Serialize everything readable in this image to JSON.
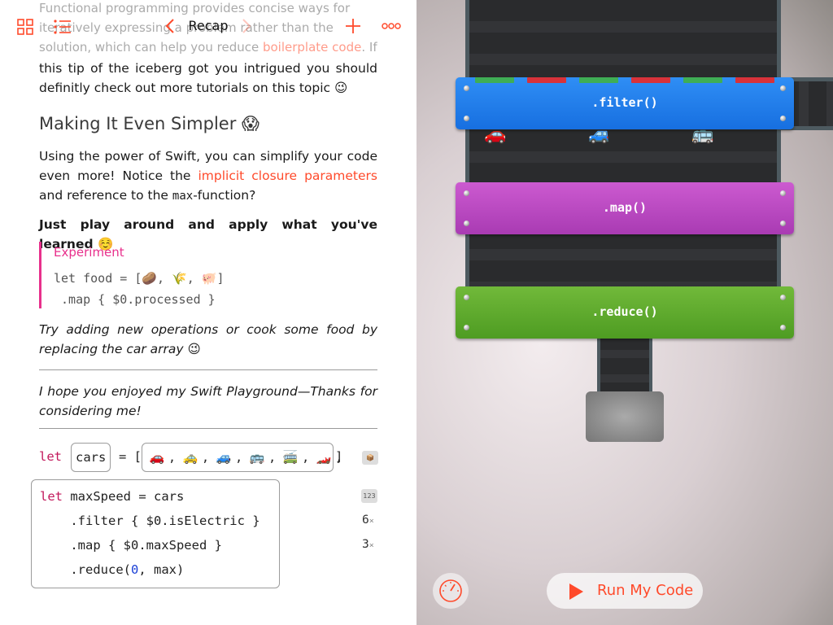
{
  "toolbar": {
    "title": "Recap"
  },
  "doc": {
    "faded_line_1": "Functional programming provides concise ways for",
    "faded_line_2": "iteratively expressing a problem rather than the",
    "faded_line_3a": "solution, which can help you reduce ",
    "faded_line_3_link": "boilerplate code",
    "faded_line_3b": ". If",
    "para1": "this tip of the iceberg got you intrigued you should definitly check out more tutorials on this topic 😉",
    "heading": "Making It Even Simpler 😱",
    "para2_a": "Using the power of Swift, you can simplify your code even more! Notice the ",
    "para2_link": "implicit closure parameters",
    "para2_b": " and reference to the ",
    "para2_mono": "max",
    "para2_c": "-function?",
    "bold_line": "Just play around and apply what you've learned ☺️",
    "experiment": {
      "label": "Experiment",
      "code_line_1": "let food = [🥔, 🌾, 🐖]",
      "code_line_2": " .map { $0.processed }"
    },
    "italic_1": "Try adding new operations or cook some food by replacing the car array 😉",
    "italic_2": "I hope you enjoyed my Swift Playground—Thanks for considering me!"
  },
  "code": {
    "let_kw": "let",
    "cars_token": "cars",
    "equals": "= [",
    "close_bracket": "]",
    "cars": [
      "🚗",
      "🚕",
      "🚙",
      "🚌",
      "🚎",
      "🏎️"
    ],
    "line1_kw": "let",
    "line1_rest": " maxSpeed = cars",
    "line2": "    .filter { $0.isElectric }",
    "line3": "    .map { $0.maxSpeed }",
    "line4_a": "    .reduce(",
    "line4_num": "0",
    "line4_b": ", max)",
    "badge_cars": "📦",
    "badge_maxspeed": "123",
    "count_filter": "6",
    "count_map": "3",
    "count_suffix": "×"
  },
  "scene": {
    "filter_label": ".filter()",
    "map_label": ".map()",
    "reduce_label": ".reduce()",
    "belt_cars": [
      "🚗",
      "🚙",
      "🚌"
    ],
    "stripe_colors": [
      "#3fae55",
      "#d8323a",
      "#3fae55",
      "#d8323a",
      "#3fae55",
      "#d8323a"
    ],
    "run_label": "Run My Code"
  },
  "colors": {
    "accent": "#ff4a2b",
    "experiment": "#e8308c",
    "filter": "#1f7ef0",
    "map": "#b847bf",
    "reduce": "#5ea82c"
  },
  "icons": {
    "grid": "grid-icon",
    "list": "list-icon",
    "back": "chevron-left-icon",
    "forward": "chevron-right-icon",
    "add": "plus-icon",
    "more": "more-icon",
    "speed": "speedometer-icon",
    "run": "play-icon"
  }
}
